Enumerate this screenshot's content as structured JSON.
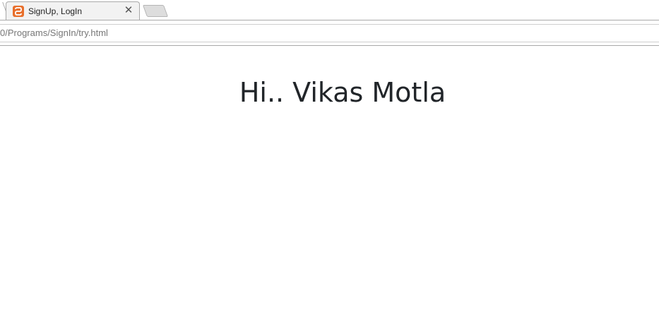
{
  "browser": {
    "tabs": [
      {
        "title": "SignUp, LogIn",
        "favicon": "xampp-icon",
        "active": true
      }
    ],
    "close_glyph": "✕",
    "url": "0/Programs/SignIn/try.html"
  },
  "page": {
    "heading": "Hi.. Vikas Motla"
  }
}
